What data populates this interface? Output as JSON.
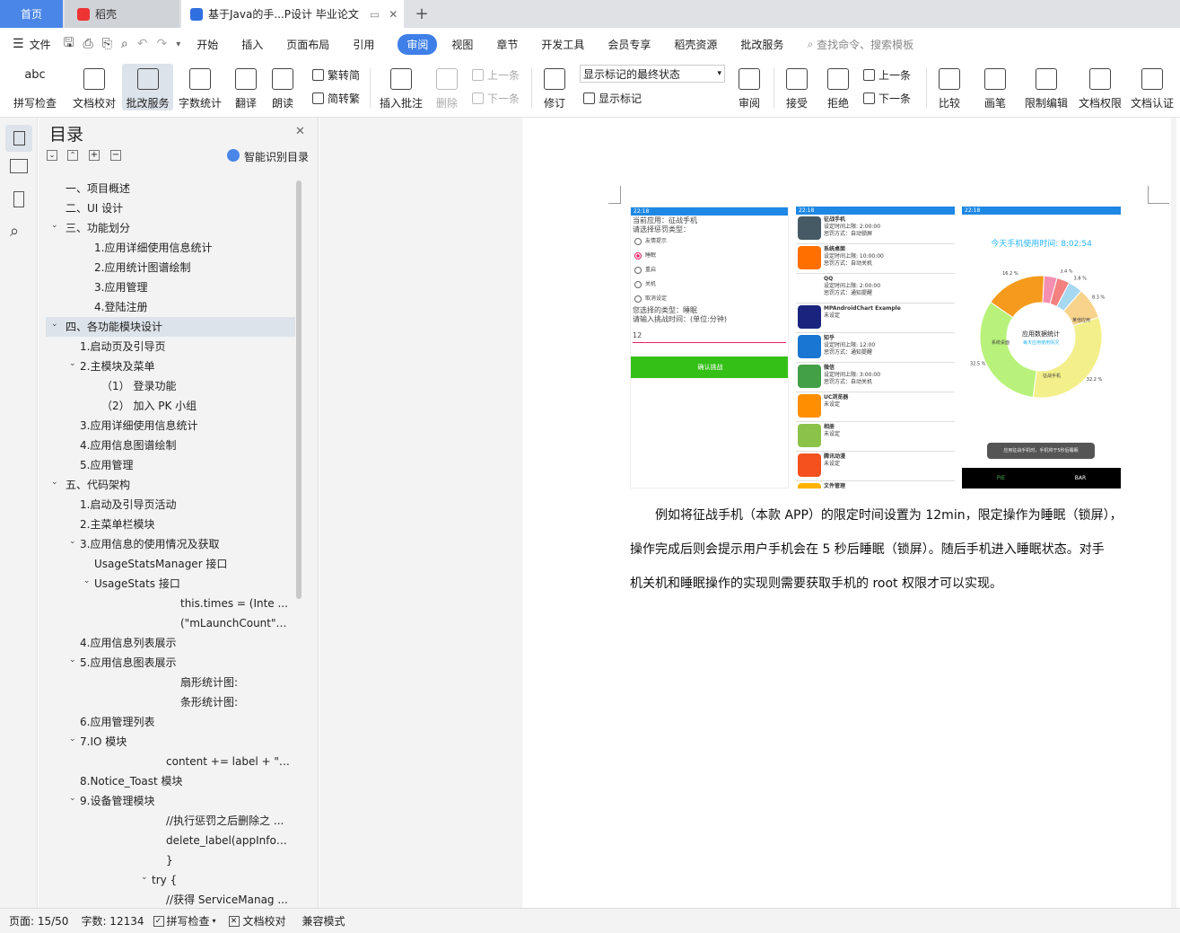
{
  "tabs": {
    "home": "首页",
    "app": "稻壳",
    "doc": "基于Java的手...P设计 毕业论文"
  },
  "menu": {
    "file": "文件",
    "items": [
      "开始",
      "插入",
      "页面布局",
      "引用",
      "审阅",
      "视图",
      "章节",
      "开发工具",
      "会员专享",
      "稻壳资源",
      "批改服务"
    ],
    "active": "审阅",
    "search": "查找命令、搜索模板"
  },
  "ribbon": {
    "spell": "拼写检查",
    "proof": "文档校对",
    "correct": "批改服务",
    "wordcount": "字数统计",
    "translate": "翻译",
    "read": "朗读",
    "t2s": "繁转简",
    "s2t": "简转繁",
    "insert_comment": "插入批注",
    "delete": "删除",
    "prev": "上一条",
    "next": "下一条",
    "revise": "修订",
    "markup_select": "显示标记的最终状态",
    "show_markup": "显示标记",
    "review": "审阅",
    "accept": "接受",
    "reject": "拒绝",
    "prev2": "上一条",
    "next2": "下一条",
    "compare": "比较",
    "pen": "画笔",
    "restrict": "限制编辑",
    "permission": "文档权限",
    "auth": "文档认证"
  },
  "toc": {
    "title": "目录",
    "smart": "智能识别目录",
    "items": [
      "一、项目概述",
      "二、UI 设计",
      "三、功能划分",
      "1.应用详细使用信息统计",
      "2.应用统计图谱绘制",
      "3.应用管理",
      "4.登陆注册",
      "四、各功能模块设计",
      "1.启动页及引导页",
      "2.主模块及菜单",
      "（1）  登录功能",
      "（2）  加入 PK 小组",
      "3.应用详细使用信息统计",
      "4.应用信息图谱绘制",
      "5.应用管理",
      "五、代码架构",
      "1.启动及引导页活动",
      "2.主菜单栏模块",
      "3.应用信息的使用情况及获取",
      "UsageStatsManager 接口",
      "UsageStats 接口",
      "this.times  =  (Inte ...",
      "(\"mLaunchCount\") ...",
      "4.应用信息列表展示",
      "5.应用信息图表展示",
      "扇形统计图:",
      "条形统计图:",
      "6.应用管理列表",
      "7.IO 模块",
      "content += label + \" ...",
      "8.Notice_Toast 模块",
      "9.设备管理模块",
      "//执行惩罚之后删除之 ...",
      "delete_label(appInfor ...",
      "}",
      "try {",
      "//获得 ServiceManag ..."
    ]
  },
  "doc": {
    "shot1": {
      "status": "22:18",
      "app_line": "当前应用：征战手机",
      "choose_line": "请选择惩罚类型：",
      "options": [
        "友情提示",
        "睡眠",
        "重启",
        "关机",
        "取消设定"
      ],
      "selected_line": "您选择的类型：睡眠",
      "input_label": "请输入挑战时间：(单位:分钟)",
      "input_value": "12",
      "button": "确认挑战"
    },
    "shot2": {
      "status": "22:18",
      "apps": [
        {
          "name": "征战手机",
          "l1": "设定时间上限: 2:00:00",
          "l2": "惩罚方式：自动锁屏"
        },
        {
          "name": "系统桌面",
          "l1": "设定时间上限: 10:00:00",
          "l2": "惩罚方式：自动关机"
        },
        {
          "name": "QQ",
          "l1": "设定时间上限: 2:00:00",
          "l2": "惩罚方式：通知提醒"
        },
        {
          "name": "MPAndroidChart Example",
          "l1": "未设定",
          "l2": ""
        },
        {
          "name": "知乎",
          "l1": "设定时间上限: 12:00",
          "l2": "惩罚方式：通知提醒"
        },
        {
          "name": "微信",
          "l1": "设定时间上限: 3:00:00",
          "l2": "惩罚方式：自动关机"
        },
        {
          "name": "UC浏览器",
          "l1": "未设定",
          "l2": ""
        },
        {
          "name": "相册",
          "l1": "未设定",
          "l2": ""
        },
        {
          "name": "腾讯动漫",
          "l1": "未设定",
          "l2": ""
        },
        {
          "name": "文件管理",
          "l1": "",
          "l2": ""
        }
      ]
    },
    "shot3": {
      "status": "22:18",
      "title": "今天手机使用时间: 8:02:54",
      "center1": "应用数据统计",
      "center2": "每天应用使用情况",
      "toast": "应用征战手机时，手机将于5秒后睡眠",
      "tab1": "PIE",
      "tab2": "BAR",
      "chart_data": {
        "type": "pie",
        "values": [
          32.5,
          32.2,
          16.2,
          8.3,
          3.8,
          3.5,
          3.4
        ],
        "labels": [
          "征战手机",
          "系统桌面",
          "某他应用",
          "8.3 %",
          "3.8 %",
          "3.5 %",
          "3.4 %"
        ],
        "percent_labels": [
          "32.5 %",
          "32.2 %",
          "16.2 %",
          "8.3 %",
          "3.8 %",
          "3.5 %",
          "3.4 %"
        ],
        "colors": [
          "#b8f27a",
          "#f3ef8a",
          "#f59a1c",
          "#f7d38c",
          "#a6d8f0",
          "#f48fb1",
          "#f48080"
        ]
      }
    },
    "paragraph": [
      "例如将征战手机（本款 APP）的限定时间设置为 12min，限定操作为睡眠（锁屏），",
      "操作完成后则会提示用户手机会在 5 秒后睡眠（锁屏）。随后手机进入睡眠状态。对手",
      "机关机和睡眠操作的实现则需要获取手机的 root 权限才可以实现。"
    ]
  },
  "status": {
    "page": "页面: 15/50",
    "words": "字数: 12134",
    "spell": "拼写检查",
    "proof": "文档校对",
    "compat": "兼容模式"
  },
  "colors": {
    "accent": "#3f7fe8",
    "green": "#35c018"
  }
}
